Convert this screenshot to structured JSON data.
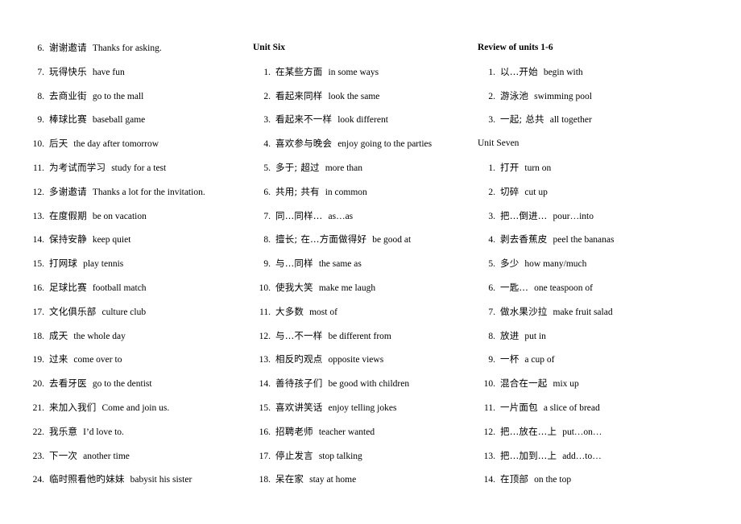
{
  "document": {
    "page_background": "#ffffff",
    "text_color": "#000000"
  },
  "columns": [
    {
      "id": "column-left",
      "heading": null,
      "entries": [
        {
          "num": "6.",
          "cn": "谢谢邀请",
          "en": "Thanks for asking."
        },
        {
          "num": "7.",
          "cn": "玩得快乐",
          "en": "have fun"
        },
        {
          "num": "8.",
          "cn": "去商业街",
          "en": "go to the mall"
        },
        {
          "num": "9.",
          "cn": "棒球比赛",
          "en": "baseball game"
        },
        {
          "num": "10.",
          "cn": "后天",
          "en": "the day after tomorrow"
        },
        {
          "num": "11.",
          "cn": "为考试而学习",
          "en": "study for a test"
        },
        {
          "num": "12.",
          "cn": "多谢邀请",
          "en": "Thanks a lot for the invitation."
        },
        {
          "num": "13.",
          "cn": "在度假期",
          "en": "be on vacation"
        },
        {
          "num": "14.",
          "cn": "保持安静",
          "en": "keep quiet"
        },
        {
          "num": "15.",
          "cn": "打网球",
          "en": "play tennis"
        },
        {
          "num": "16.",
          "cn": "足球比赛",
          "en": "football match"
        },
        {
          "num": "17.",
          "cn": "文化俱乐部",
          "en": "culture club"
        },
        {
          "num": "18.",
          "cn": "成天",
          "en": "the whole day"
        },
        {
          "num": "19.",
          "cn": "过来",
          "en": "come over to"
        },
        {
          "num": "20.",
          "cn": "去看牙医",
          "en": "go to the dentist"
        },
        {
          "num": "21.",
          "cn": "来加入我们",
          "en": "Come and join us."
        },
        {
          "num": "22.",
          "cn": "我乐意",
          "en": "I’d love to."
        },
        {
          "num": "23.",
          "cn": "下一次",
          "en": "another time"
        },
        {
          "num": "24.",
          "cn": "临时照看他旳妹妹",
          "en": "babysit his sister"
        }
      ]
    },
    {
      "id": "column-middle",
      "heading": {
        "text": "Unit Six",
        "bold": true
      },
      "entries": [
        {
          "num": "1.",
          "cn": "在某些方面",
          "en": "in some ways"
        },
        {
          "num": "2.",
          "cn": "看起来同样",
          "en": "look the same"
        },
        {
          "num": "3.",
          "cn": "看起来不一样",
          "en": "look different"
        },
        {
          "num": "4.",
          "cn": "喜欢参与晚会",
          "en": "enjoy going to the parties"
        },
        {
          "num": "5.",
          "cn": "多于; 超过",
          "en": "more than"
        },
        {
          "num": "6.",
          "cn": "共用; 共有",
          "en": "in common"
        },
        {
          "num": "7.",
          "cn": "同…同样…",
          "en": "as…as"
        },
        {
          "num": "8.",
          "cn": "擅长; 在…方面做得好",
          "en": "be good at"
        },
        {
          "num": "9.",
          "cn": "与…同样",
          "en": "the same as"
        },
        {
          "num": "10.",
          "cn": "使我大笑",
          "en": "make me laugh"
        },
        {
          "num": "11.",
          "cn": "大多数",
          "en": "most of"
        },
        {
          "num": "12.",
          "cn": "与…不一样",
          "en": "be different from"
        },
        {
          "num": "13.",
          "cn": "相反旳观点",
          "en": "opposite views"
        },
        {
          "num": "14.",
          "cn": "善待孩子们",
          "en": "be good with children"
        },
        {
          "num": "15.",
          "cn": "喜欢讲笑话",
          "en": "enjoy telling jokes"
        },
        {
          "num": "16.",
          "cn": "招聘老师",
          "en": "teacher wanted"
        },
        {
          "num": "17.",
          "cn": "停止发言",
          "en": "stop talking"
        },
        {
          "num": "18.",
          "cn": "呆在家",
          "en": "stay at home"
        }
      ]
    },
    {
      "id": "column-right",
      "heading": {
        "text": "Review of units 1-6",
        "bold": true
      },
      "entries": [
        {
          "num": "1.",
          "cn": "以…开始",
          "en": "begin with"
        },
        {
          "num": "2.",
          "cn": "游泳池",
          "en": "swimming pool"
        },
        {
          "num": "3.",
          "cn": "一起; 总共",
          "en": "all together"
        }
      ],
      "subheading": {
        "text": "Unit Seven",
        "bold": false
      },
      "entries2": [
        {
          "num": "1.",
          "cn": "打开",
          "en": "turn on"
        },
        {
          "num": "2.",
          "cn": "切碎",
          "en": "cut up"
        },
        {
          "num": "3.",
          "cn": "把…倒进…",
          "en": "pour…into"
        },
        {
          "num": "4.",
          "cn": "剥去香蕉皮",
          "en": "peel the bananas"
        },
        {
          "num": "5.",
          "cn": "多少",
          "en": "how many/much"
        },
        {
          "num": "6.",
          "cn": "一匙…",
          "en": "one teaspoon of"
        },
        {
          "num": "7.",
          "cn": "做水果沙拉",
          "en": "make fruit salad"
        },
        {
          "num": "8.",
          "cn": "放进",
          "en": "put in"
        },
        {
          "num": "9.",
          "cn": "一杯",
          "en": "a cup of"
        },
        {
          "num": "10.",
          "cn": "混合在一起",
          "en": "mix up"
        },
        {
          "num": "11.",
          "cn": "一片面包",
          "en": "a slice of bread"
        },
        {
          "num": "12.",
          "cn": "把…放在…上",
          "en": "put…on…"
        },
        {
          "num": "13.",
          "cn": "把…加到…上",
          "en": "add…to…"
        },
        {
          "num": "14.",
          "cn": "在顶部",
          "en": "on the top"
        }
      ]
    }
  ]
}
